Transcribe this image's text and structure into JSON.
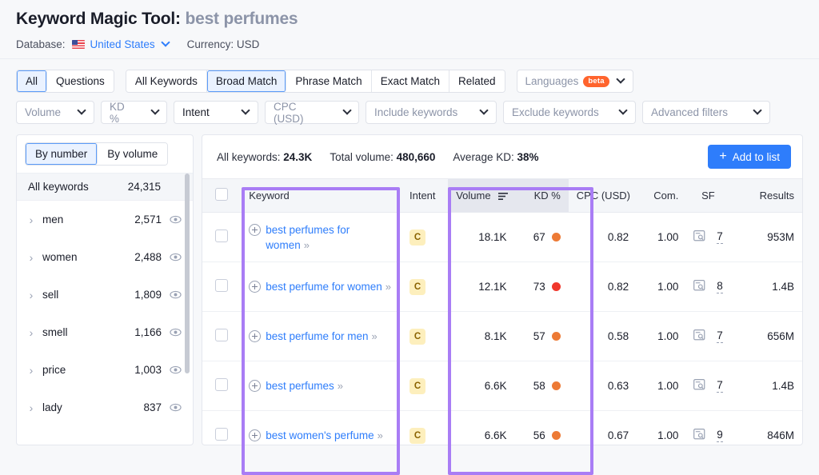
{
  "header": {
    "tool_name": "Keyword Magic Tool:",
    "query": "best perfumes",
    "database_label": "Database:",
    "database_value": "United States",
    "currency_label": "Currency: USD"
  },
  "toolbar": {
    "question_tabs": [
      {
        "label": "All",
        "active": true
      },
      {
        "label": "Questions",
        "active": false
      }
    ],
    "match_tabs": [
      {
        "label": "All Keywords",
        "active": false
      },
      {
        "label": "Broad Match",
        "active": true
      },
      {
        "label": "Phrase Match",
        "active": false
      },
      {
        "label": "Exact Match",
        "active": false
      },
      {
        "label": "Related",
        "active": false
      }
    ],
    "languages_label": "Languages",
    "languages_badge": "beta",
    "filters": [
      {
        "label": "Volume",
        "muted": true
      },
      {
        "label": "KD %",
        "muted": true
      },
      {
        "label": "Intent",
        "muted": false
      },
      {
        "label": "CPC (USD)",
        "muted": true
      },
      {
        "label": "Include keywords",
        "muted": true
      },
      {
        "label": "Exclude keywords",
        "muted": true
      },
      {
        "label": "Advanced filters",
        "muted": true
      }
    ]
  },
  "sidebar": {
    "modes": [
      {
        "label": "By number",
        "active": true
      },
      {
        "label": "By volume",
        "active": false
      }
    ],
    "all_keywords_label": "All keywords",
    "all_keywords_count": "24,315",
    "groups": [
      {
        "name": "men",
        "count": "2,571"
      },
      {
        "name": "women",
        "count": "2,488"
      },
      {
        "name": "sell",
        "count": "1,809"
      },
      {
        "name": "smell",
        "count": "1,166"
      },
      {
        "name": "price",
        "count": "1,003"
      },
      {
        "name": "lady",
        "count": "837"
      }
    ]
  },
  "summary": {
    "all_keywords": "All keywords: ",
    "all_keywords_value": "24.3K",
    "total_volume": "Total volume: ",
    "total_volume_value": "480,660",
    "average_kd": "Average KD: ",
    "average_kd_value": "38%",
    "add_to_list": "Add to list",
    "add_icon": "plus-icon"
  },
  "table": {
    "columns": [
      {
        "label": "Keyword",
        "align": "left"
      },
      {
        "label": "Intent",
        "align": "left"
      },
      {
        "label": "Volume",
        "align": "right",
        "sorted": true,
        "sort_icon": "sort-descending-icon"
      },
      {
        "label": "KD %",
        "align": "right"
      },
      {
        "label": "CPC (USD)",
        "align": "right"
      },
      {
        "label": "Com.",
        "align": "right"
      },
      {
        "label": "SF",
        "align": "center"
      },
      {
        "label": "Results",
        "align": "right"
      }
    ],
    "rows": [
      {
        "keyword": "best perfumes for women",
        "intent": "C",
        "volume": "18.1K",
        "kd": "67",
        "kd_color": "#ed7a35",
        "cpc": "0.82",
        "com": "1.00",
        "sf": "7",
        "results": "953M"
      },
      {
        "keyword": "best perfume for women",
        "intent": "C",
        "volume": "12.1K",
        "kd": "73",
        "kd_color": "#f0372c",
        "cpc": "0.82",
        "com": "1.00",
        "sf": "8",
        "results": "1.4B"
      },
      {
        "keyword": "best perfume for men",
        "intent": "C",
        "volume": "8.1K",
        "kd": "57",
        "kd_color": "#ed7a35",
        "cpc": "0.58",
        "com": "1.00",
        "sf": "7",
        "results": "656M"
      },
      {
        "keyword": "best perfumes",
        "intent": "C",
        "volume": "6.6K",
        "kd": "58",
        "kd_color": "#ed7a35",
        "cpc": "0.63",
        "com": "1.00",
        "sf": "7",
        "results": "1.4B"
      },
      {
        "keyword": "best women's perfume",
        "intent": "C",
        "volume": "6.6K",
        "kd": "56",
        "kd_color": "#ed7a35",
        "cpc": "0.67",
        "com": "1.00",
        "sf": "9",
        "results": "846M"
      }
    ]
  },
  "annotations": {
    "highlight_color": "#a97df5",
    "boxes": [
      "keyword-column-highlight",
      "volume-kd-columns-highlight"
    ]
  }
}
